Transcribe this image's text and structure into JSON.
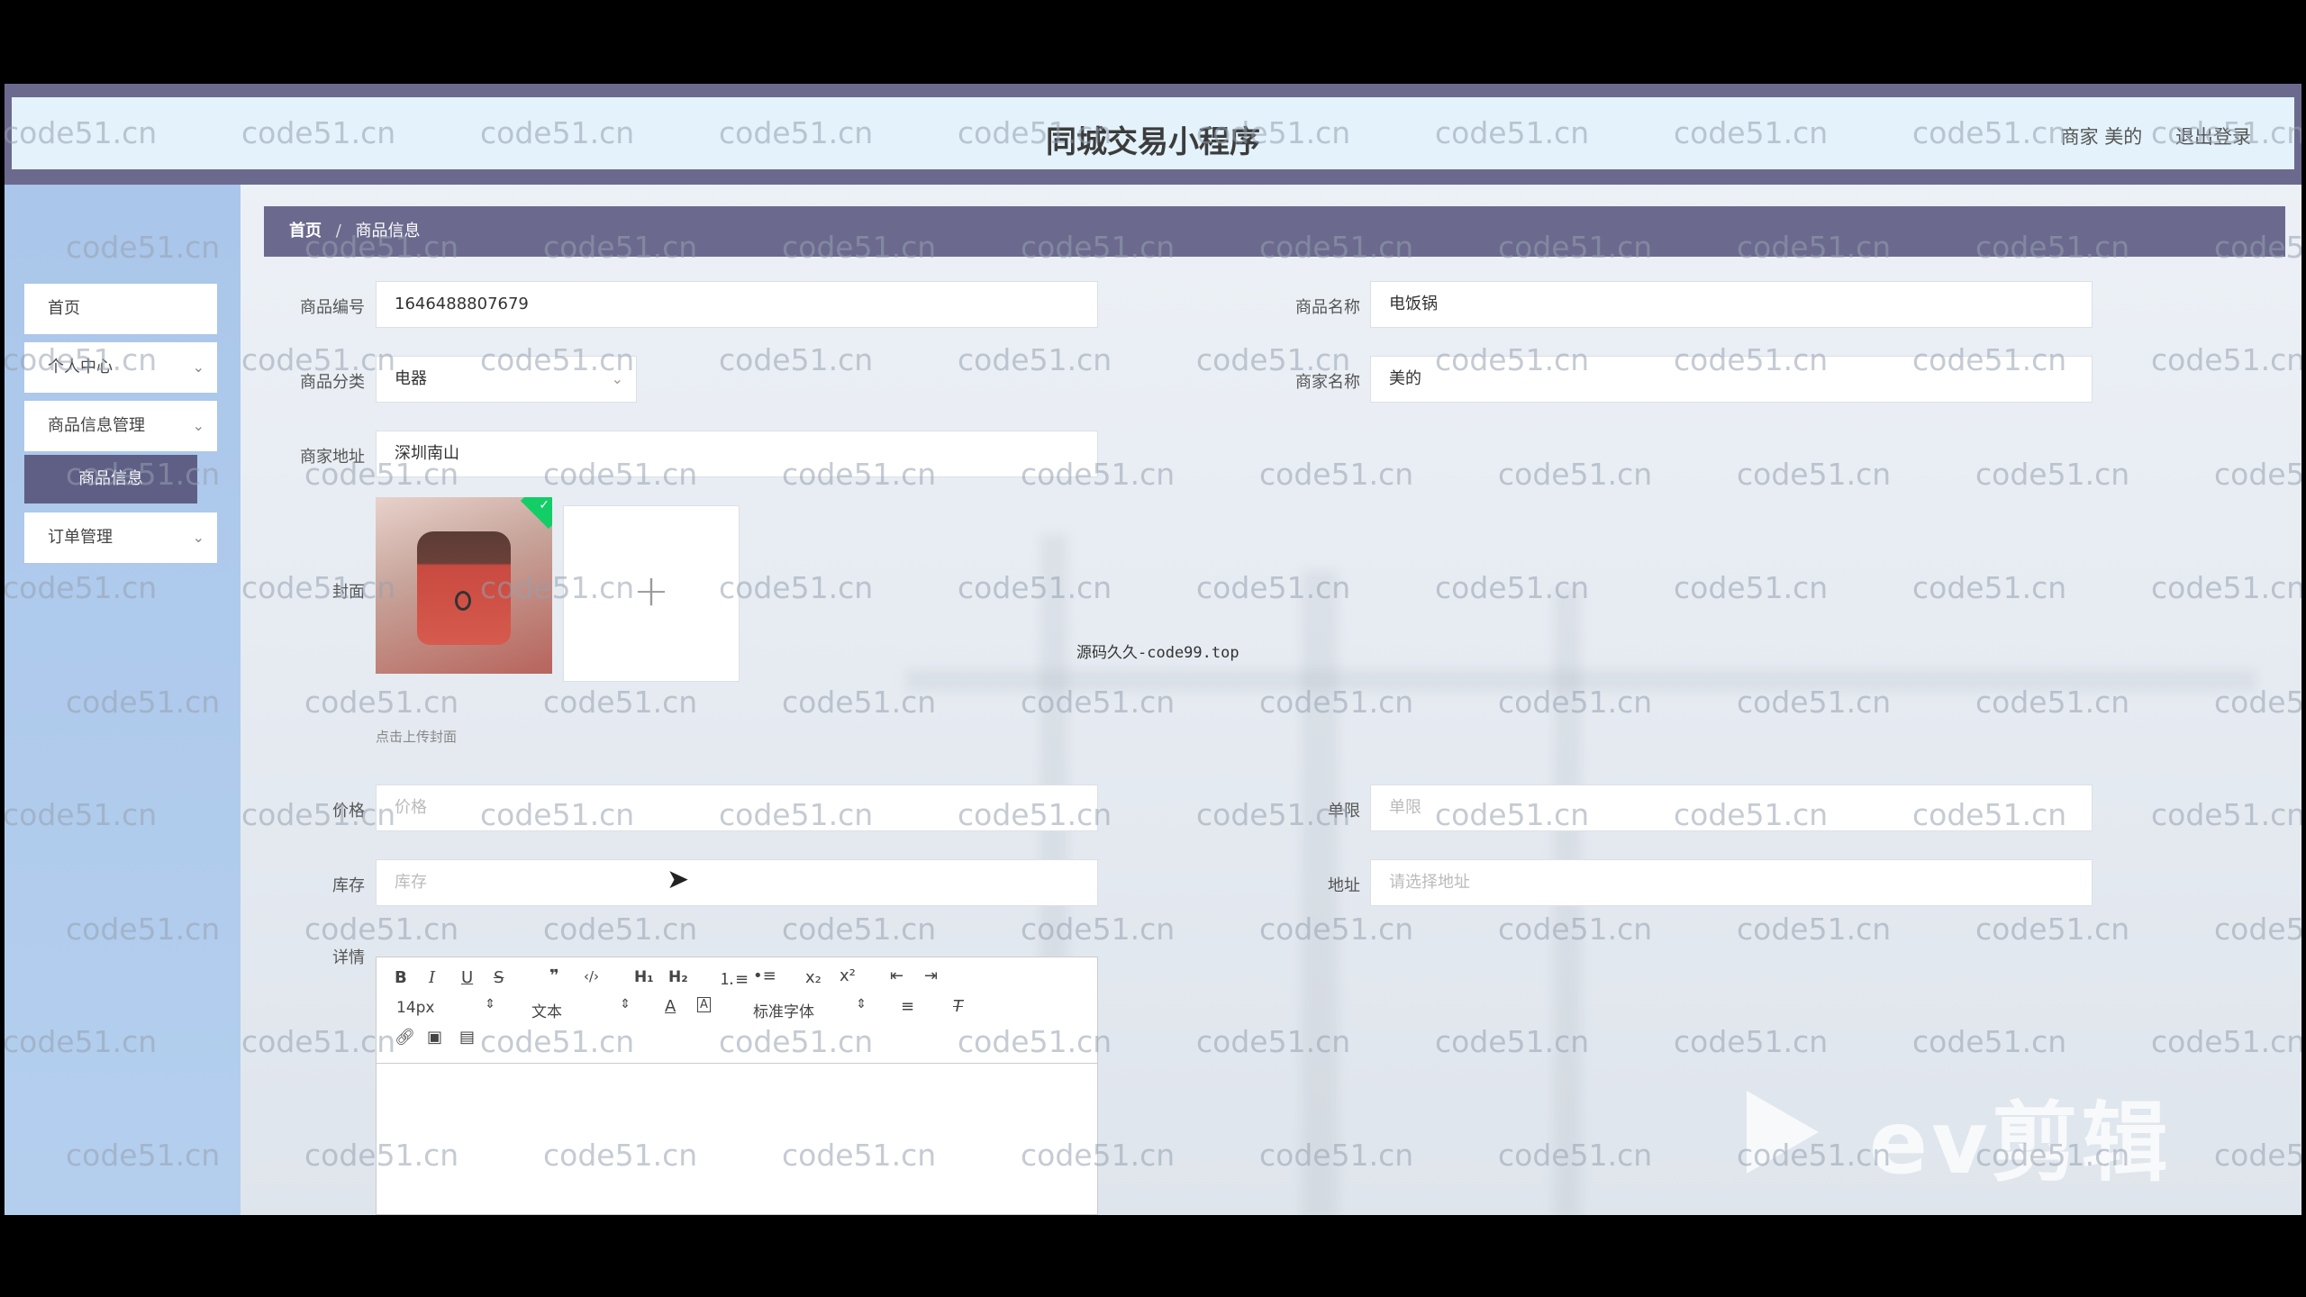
{
  "header": {
    "title": "同城交易小程序",
    "merchant_label": "商家 美的",
    "logout_label": "退出登录"
  },
  "sidebar": {
    "items": [
      {
        "label": "首页"
      },
      {
        "label": "个人中心"
      },
      {
        "label": "商品信息管理"
      },
      {
        "label": "订单管理"
      }
    ],
    "active_sub": "商品信息"
  },
  "breadcrumb": {
    "home": "首页",
    "sep": "/",
    "current": "商品信息"
  },
  "form": {
    "code_label": "商品编号",
    "code_value": "1646488807679",
    "name_label": "商品名称",
    "name_value": "电饭锅",
    "category_label": "商品分类",
    "category_value": "电器",
    "merchant_name_label": "商家名称",
    "merchant_name_value": "美的",
    "address_label": "商家地址",
    "address_value": "深圳南山",
    "cover_label": "封面",
    "upload_hint": "点击上传封面",
    "price_label": "价格",
    "price_placeholder": "价格",
    "limit_label": "单限",
    "limit_placeholder": "单限",
    "stock_label": "库存",
    "stock_placeholder": "库存",
    "location_label": "地址",
    "location_placeholder": "请选择地址",
    "detail_label": "详情"
  },
  "editor": {
    "font_size": "14px",
    "text_type": "文本",
    "font_family": "标准字体"
  },
  "overlay": {
    "watermark": "code51.cn",
    "center_note": "源码久久-code99.top",
    "video_logo": "ev剪辑"
  },
  "colors": {
    "header_bg": "#6b6a8e",
    "header_inner": "#e3f2fb",
    "sidebar_bg": "#aac6ea",
    "active_item": "#5f5f86"
  }
}
